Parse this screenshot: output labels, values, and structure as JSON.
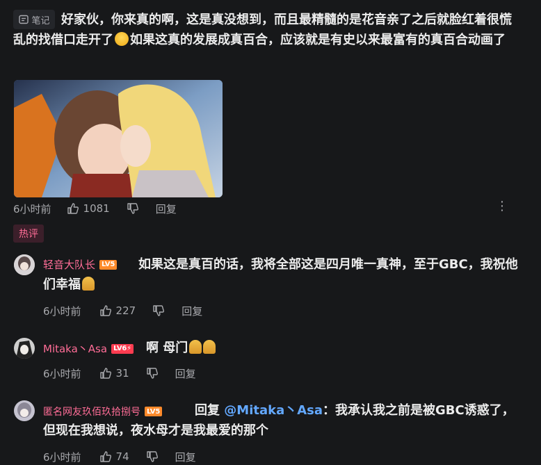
{
  "post": {
    "note_label": "笔记",
    "text_part1": "好家伙，你来真的啊，这是真没想到，而且最精髓的是花音亲了之后就脸红着很慌乱的找借口走开了",
    "text_part2": "如果这真的发展成真百合，应该就是有史以来最富有的真百合动画了",
    "time": "6小时前",
    "likes": "1081",
    "reply_label": "回复"
  },
  "hot_label": "热评",
  "comments": [
    {
      "username": "轻音大队长",
      "level": "LV5",
      "text": "如果这是真百的话，我将全部这是四月唯一真神，至于GBC，我祝他们幸福",
      "time": "6小时前",
      "likes": "227",
      "reply_label": "回复"
    },
    {
      "username": "Mitaka丶Asa",
      "level": "LV6",
      "level_extra": "⚡",
      "text": "啊 母门",
      "time": "6小时前",
      "likes": "31",
      "reply_label": "回复"
    },
    {
      "username": "匿名网友玖佰玖拾捌号",
      "level": "LV5",
      "reply_prefix": "回复 ",
      "mention": "@Mitaka丶Asa",
      "text": "：我承认我之前是被GBC诱惑了，但现在我想说，夜水母才是我最爱的那个",
      "time": "6小时前",
      "likes": "74",
      "reply_label": "回复"
    }
  ],
  "colors": {
    "background": "#17181a",
    "username": "#ff6d97",
    "mention": "#63a8ff",
    "hot_tag_text": "#ff6d97",
    "lv5_badge": "#ff8a2b",
    "lv6_badge": "#ff3c50"
  }
}
